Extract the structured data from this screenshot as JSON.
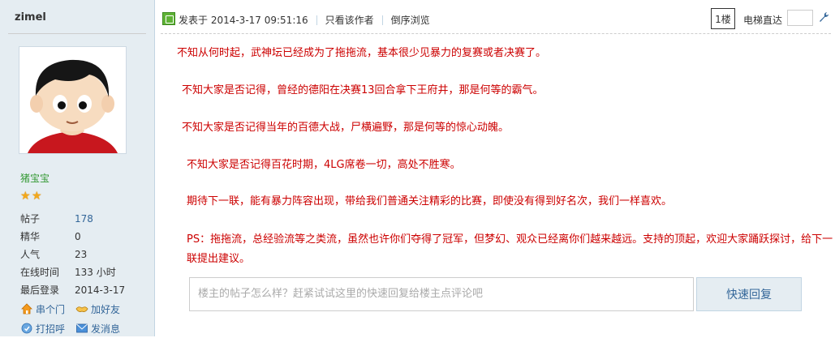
{
  "author": {
    "username": "zimel",
    "rank": "猪宝宝",
    "star_count": 2,
    "stats": [
      {
        "label": "帖子",
        "value": "178",
        "is_link": true
      },
      {
        "label": "精华",
        "value": "0",
        "is_link": false
      },
      {
        "label": "人气",
        "value": "23",
        "is_link": false
      },
      {
        "label": "在线时间",
        "value": "133 小时",
        "is_link": false
      },
      {
        "label": "最后登录",
        "value": "2014-3-17",
        "is_link": false
      }
    ],
    "actions": {
      "visit": "串个门",
      "add_friend": "加好友",
      "greet": "打招呼",
      "message": "发消息"
    }
  },
  "post_header": {
    "posted_at": "发表于 2014-3-17 09:51:16",
    "only_author": "只看该作者",
    "reverse_view": "倒序浏览",
    "floor": "1楼",
    "jump_label": "电梯直达"
  },
  "content": {
    "paragraphs": [
      "不知从何时起，武神坛已经成为了拖拖流，基本很少见暴力的复赛或者决赛了。",
      "不知大家是否记得，曾经的德阳在决赛13回合拿下王府井，那是何等的霸气。",
      "不知大家是否记得当年的百德大战，尸横遍野，那是何等的惊心动魄。",
      "不知大家是否记得百花时期，4LG席卷一切，高处不胜寒。",
      "期待下一联，能有暴力阵容出现，带给我们普通关注精彩的比赛，即使没有得到好名次，我们一样喜欢。",
      "PS：拖拖流，总经验流等之类流，虽然也许你们夺得了冠军，但梦幻、观众已经离你们越来越远。支持的顶起，欢迎大家踊跃探讨，给下一联提出建议。"
    ]
  },
  "reply": {
    "placeholder": "楼主的帖子怎么样？赶紧试试这里的快速回复给楼主点评论吧",
    "button": "快速回复"
  },
  "colors": {
    "content_text": "#cc0000",
    "sidebar_bg": "#e5edf2",
    "link": "#336699",
    "rank": "#339933"
  }
}
